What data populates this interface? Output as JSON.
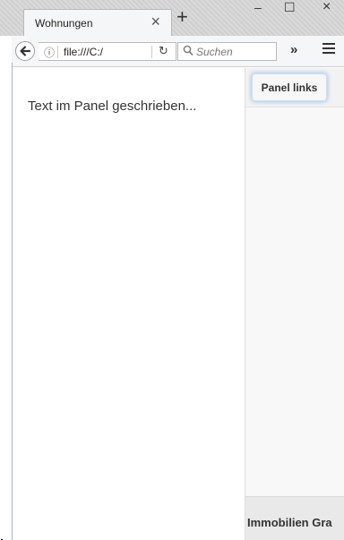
{
  "browser": {
    "tab_title": "Wohnungen",
    "tab_close": "×",
    "new_tab": "+",
    "url": "file:///C:/",
    "search_placeholder": "Suchen",
    "overflow": "»",
    "window_controls": {
      "minimize": "–",
      "maximize": "☐",
      "close": "×"
    }
  },
  "content": {
    "left_panel_text": "Text im Panel geschrieben...",
    "panel_button_label": "Panel links",
    "footer_title": "Immobilien Gra"
  },
  "colors": {
    "panel_button_glow": "#a7c8ea",
    "footer_bg": "#e9e9e9"
  },
  "icons": [
    "back-arrow-icon",
    "info-icon",
    "reload-icon",
    "search-icon",
    "overflow-icon",
    "hamburger-menu-icon"
  ]
}
